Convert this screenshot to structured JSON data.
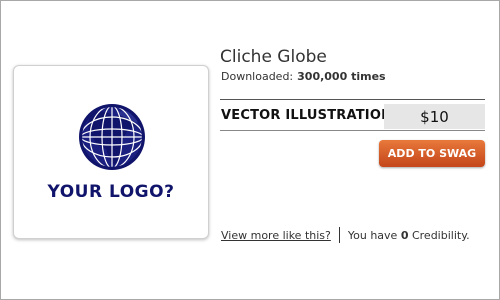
{
  "product": {
    "title": "Cliche Globe",
    "downloads_label": "Downloaded:",
    "downloads_count": "300,000 times"
  },
  "thumbnail": {
    "logo_text": "YOUR LOGO?",
    "icon": "globe-icon",
    "color": "#11146b"
  },
  "license": {
    "label": "VECTOR ILLUSTRATION",
    "price": "$10"
  },
  "actions": {
    "add_to_swag_label": "ADD TO SWAG",
    "button_color": "#d65a26"
  },
  "footer": {
    "view_more_link": "View more like this?",
    "credibility_prefix": "You have",
    "credibility_value": "0",
    "credibility_suffix": "Credibility."
  }
}
